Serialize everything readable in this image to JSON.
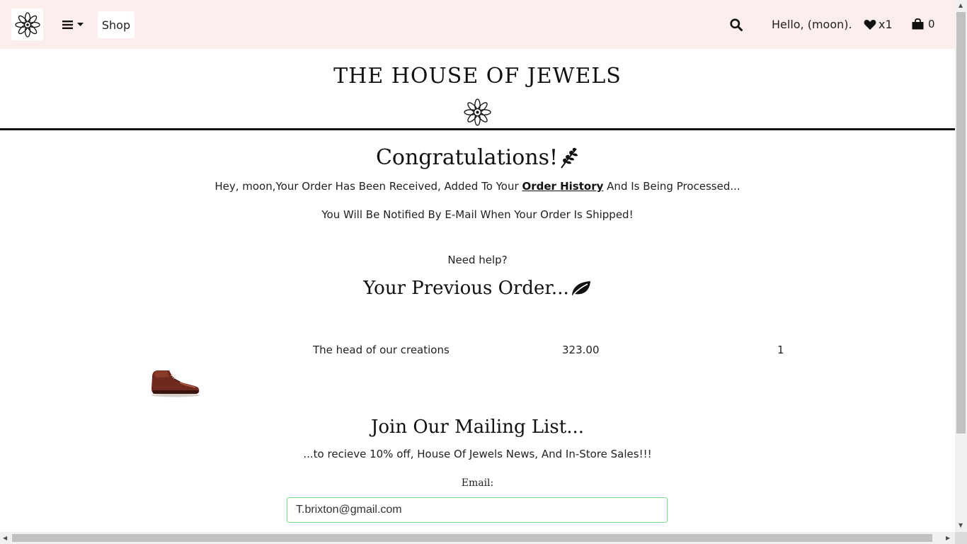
{
  "navbar": {
    "shop_label": "Shop",
    "greeting": "Hello, (moon).",
    "wishlist_count": "x1",
    "cart_count": "0",
    "logo_icon": "flower-mandala-icon",
    "menu_icon": "hamburger-icon",
    "search_icon": "search-icon",
    "wishlist_icon": "heart-icon",
    "cart_icon": "shopping-bag-icon"
  },
  "header": {
    "site_title": "THE HOUSE OF JEWELS"
  },
  "confirmation": {
    "heading": "Congratulations!",
    "heading_icon": "sprig-icon",
    "line1_before": "Hey, moon,Your Order Has Been Received, Added To Your ",
    "order_history_link": "Order History",
    "line1_after": " And Is Being Processed...",
    "line2": "You Will Be Notified By E-Mail When Your Order Is Shipped!",
    "help": "Need help?"
  },
  "previous_order": {
    "heading": "Your Previous Order...",
    "heading_icon": "leaf-icon",
    "items": [
      {
        "name": "The head of our creations",
        "price": "323.00",
        "quantity": "1",
        "image": "brown-leather-shoe"
      }
    ]
  },
  "mailing_list": {
    "heading": "Join Our Mailing List...",
    "subtitle": "...to recieve 10% off, House Of Jewels News, And In-Store Sales!!!",
    "email_label": "Email:",
    "email_value": "T.brixton@gmail.com"
  },
  "colors": {
    "navbar_bg": "#fdeeee",
    "input_border": "#7ddc8a",
    "text": "#111111"
  }
}
